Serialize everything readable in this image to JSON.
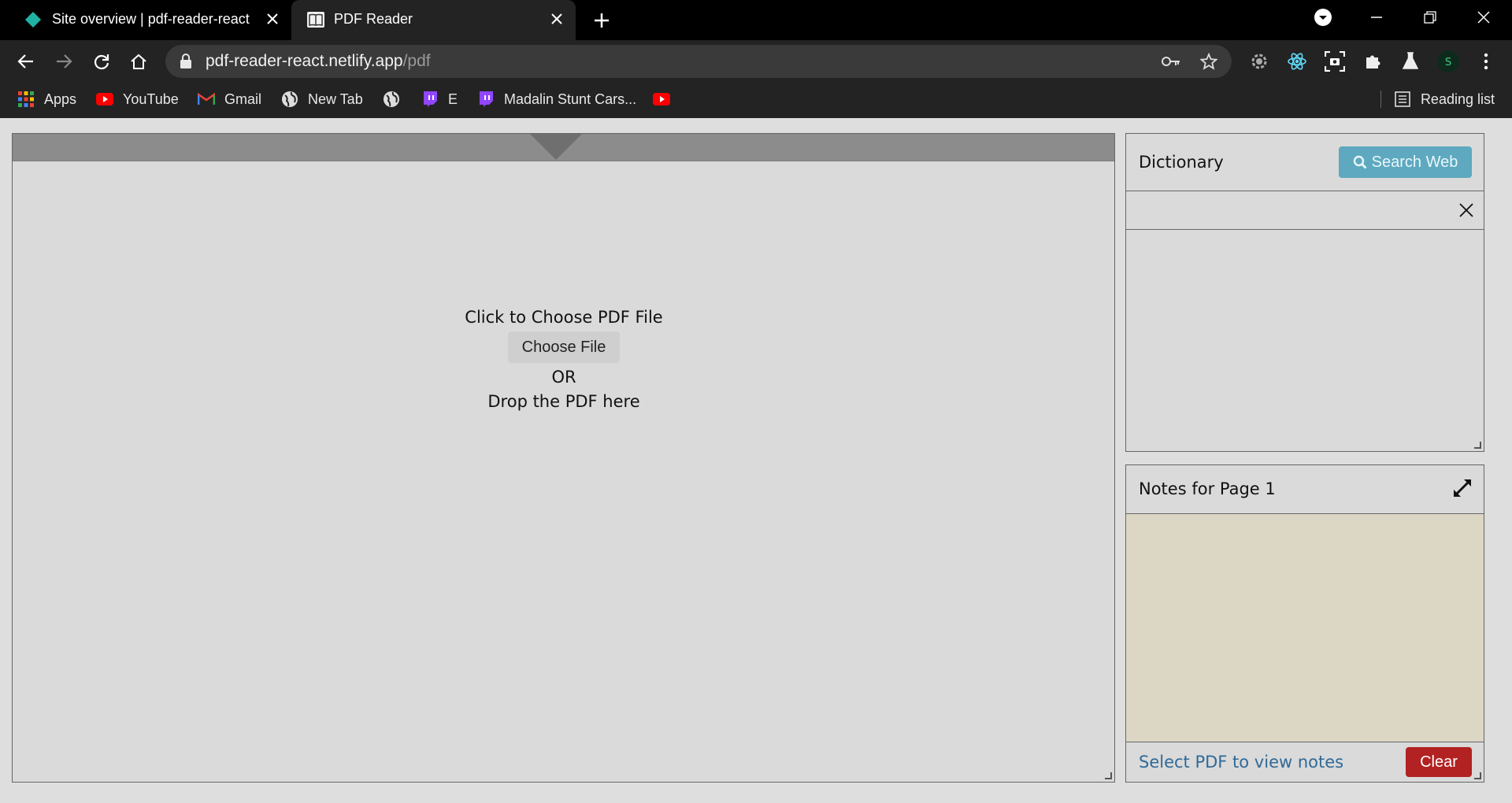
{
  "browser": {
    "tabs": [
      {
        "title": "Site overview | pdf-reader-react",
        "icon": "netlify-diamond-icon",
        "active": false
      },
      {
        "title": "PDF Reader",
        "icon": "book-icon",
        "active": true
      }
    ],
    "address": {
      "host": "pdf-reader-react.netlify.app",
      "path": "/pdf"
    },
    "bookmarks": [
      {
        "label": "Apps",
        "icon": "apps-grid-icon"
      },
      {
        "label": "YouTube",
        "icon": "youtube-icon"
      },
      {
        "label": "Gmail",
        "icon": "gmail-icon"
      },
      {
        "label": "New Tab",
        "icon": "globe-icon"
      },
      {
        "label": "",
        "icon": "globe-icon"
      },
      {
        "label": "E",
        "icon": "twitch-icon"
      },
      {
        "label": "Madalin Stunt Cars...",
        "icon": "twitch-icon"
      },
      {
        "label": "",
        "icon": "youtube-icon"
      }
    ],
    "reading_list": "Reading list"
  },
  "pdf": {
    "prompt": "Click to Choose PDF File",
    "choose_button": "Choose File",
    "or_text": "OR",
    "drop_text": "Drop the PDF here"
  },
  "dictionary": {
    "title": "Dictionary",
    "search_button": "Search Web"
  },
  "notes": {
    "title": "Notes for Page 1",
    "hint": "Select PDF to view notes",
    "clear_button": "Clear"
  },
  "colors": {
    "search_button": "#5ea9bf",
    "clear_button": "#b22222",
    "notes_background": "#dcd6c4",
    "hint_text": "#2f6a98"
  }
}
